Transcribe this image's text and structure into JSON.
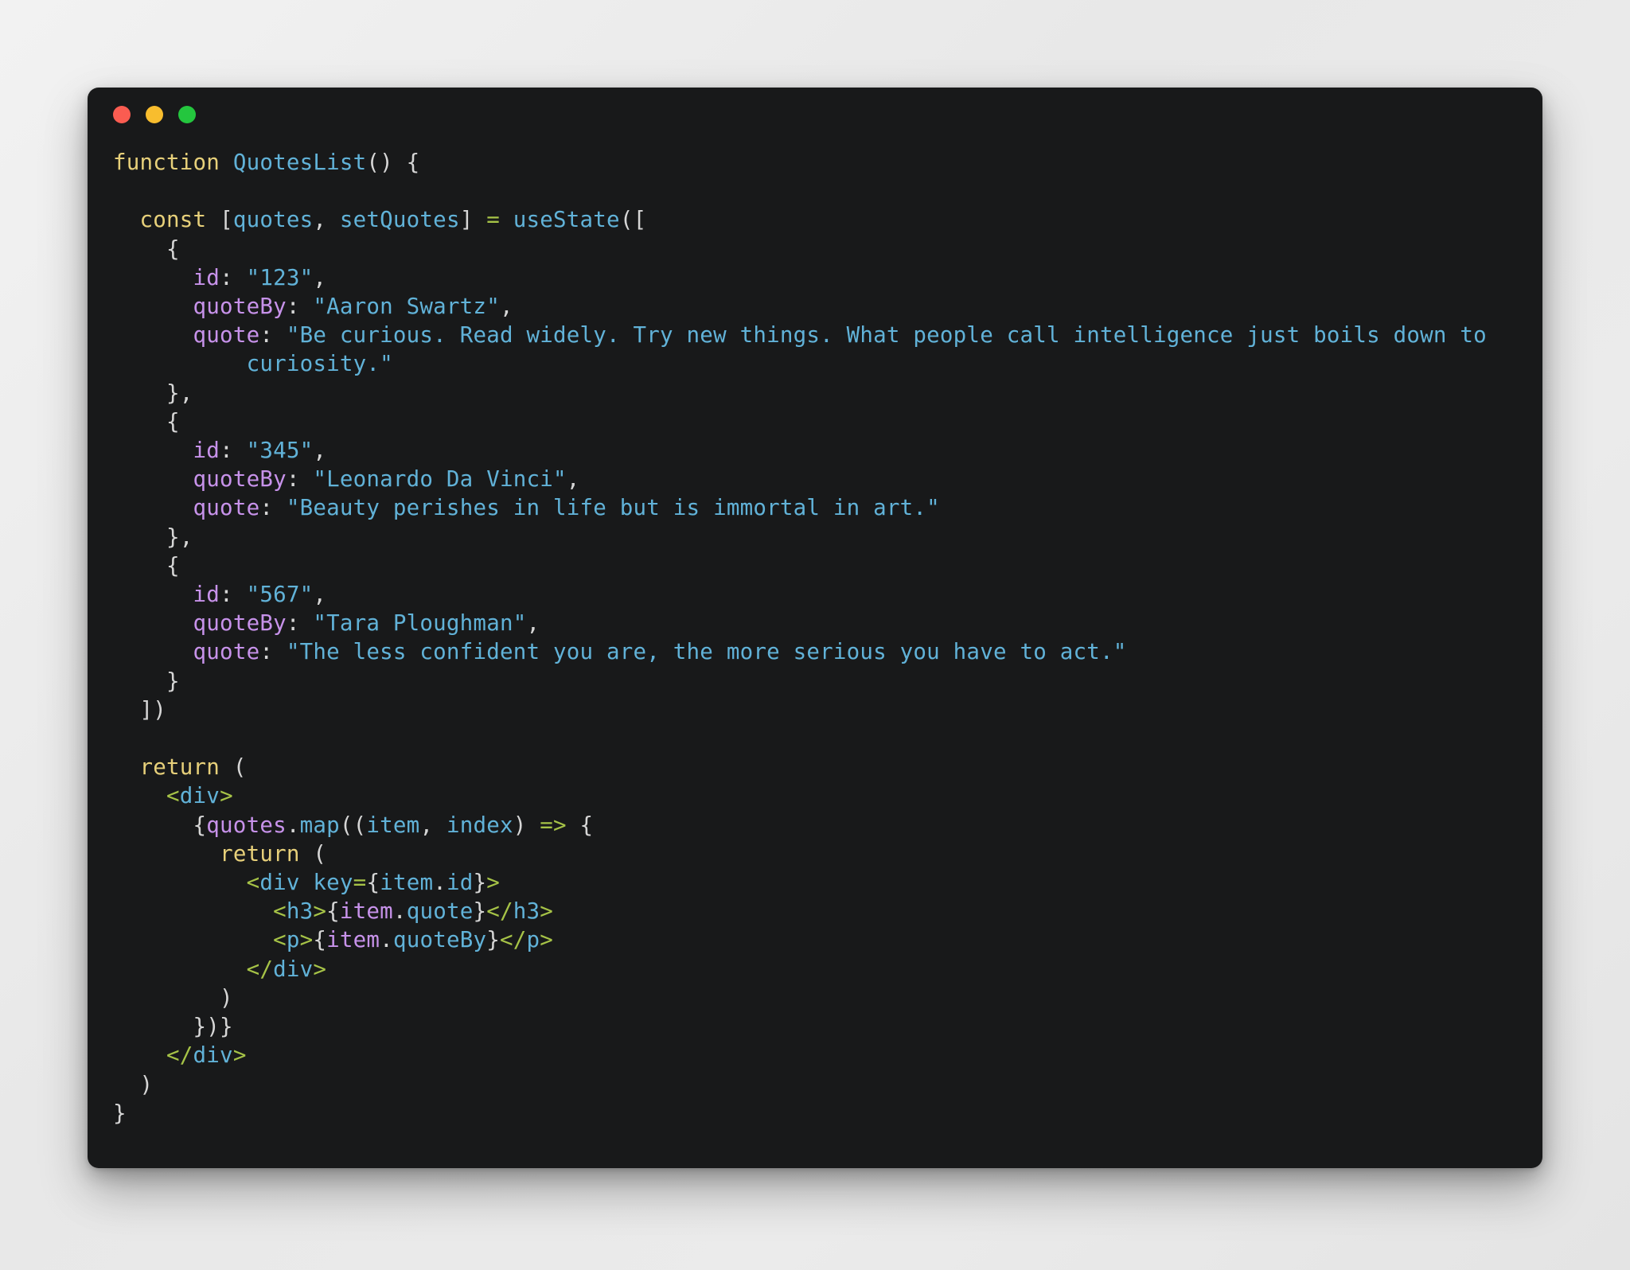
{
  "window": {
    "traffic_lights": [
      {
        "name": "close-button",
        "color": "#fa5c51"
      },
      {
        "name": "minimize-button",
        "color": "#f8bd2e"
      },
      {
        "name": "maximize-button",
        "color": "#24c63e"
      }
    ]
  },
  "theme": {
    "page_background": "#ebebeb",
    "window_background": "#18191a",
    "keyword": "#e7d07a",
    "identifier": "#61b2d8",
    "string": "#61b2d8",
    "operator": "#a6c347",
    "variable": "#c792ea",
    "punctuation": "#d6d6d6"
  },
  "code": {
    "language": "jsx",
    "component_name": "QuotesList",
    "state_hook": "useState",
    "state_variable": "quotes",
    "state_setter": "setQuotes",
    "quotes": [
      {
        "id": "123",
        "quoteBy": "Aaron Swartz",
        "quote": "Be curious. Read widely. Try new things. What people call intelligence just boils down to curiosity."
      },
      {
        "id": "345",
        "quoteBy": "Leonardo Da Vinci",
        "quote": "Beauty perishes in life but is immortal in art."
      },
      {
        "id": "567",
        "quoteBy": "Tara Ploughman",
        "quote": "The less confident you are, the more serious you have to act."
      }
    ],
    "lines": [
      [
        {
          "t": "function ",
          "c": "kw"
        },
        {
          "t": "QuotesList",
          "c": "fn"
        },
        {
          "t": "() {",
          "c": "pun"
        }
      ],
      [
        {
          "t": "",
          "c": "pun"
        }
      ],
      [
        {
          "t": "  ",
          "c": "pun"
        },
        {
          "t": "const",
          "c": "kw"
        },
        {
          "t": " [",
          "c": "pun"
        },
        {
          "t": "quotes",
          "c": "fn"
        },
        {
          "t": ", ",
          "c": "pun"
        },
        {
          "t": "setQuotes",
          "c": "fn"
        },
        {
          "t": "] ",
          "c": "pun"
        },
        {
          "t": "=",
          "c": "op"
        },
        {
          "t": " ",
          "c": "pun"
        },
        {
          "t": "useState",
          "c": "fn"
        },
        {
          "t": "([",
          "c": "pun"
        }
      ],
      [
        {
          "t": "    {",
          "c": "pun"
        }
      ],
      [
        {
          "t": "      ",
          "c": "pun"
        },
        {
          "t": "id",
          "c": "var"
        },
        {
          "t": ": ",
          "c": "pun"
        },
        {
          "t": "\"123\"",
          "c": "str"
        },
        {
          "t": ",",
          "c": "pun"
        }
      ],
      [
        {
          "t": "      ",
          "c": "pun"
        },
        {
          "t": "quoteBy",
          "c": "var"
        },
        {
          "t": ": ",
          "c": "pun"
        },
        {
          "t": "\"Aaron Swartz\"",
          "c": "str"
        },
        {
          "t": ",",
          "c": "pun"
        }
      ],
      [
        {
          "t": "      ",
          "c": "pun"
        },
        {
          "t": "quote",
          "c": "var"
        },
        {
          "t": ": ",
          "c": "pun"
        },
        {
          "t": "\"Be curious. Read widely. Try new things. What people call intelligence just boils down to",
          "c": "str"
        }
      ],
      [
        {
          "t": "          ",
          "c": "pun"
        },
        {
          "t": "curiosity.\"",
          "c": "str"
        }
      ],
      [
        {
          "t": "    },",
          "c": "pun"
        }
      ],
      [
        {
          "t": "    {",
          "c": "pun"
        }
      ],
      [
        {
          "t": "      ",
          "c": "pun"
        },
        {
          "t": "id",
          "c": "var"
        },
        {
          "t": ": ",
          "c": "pun"
        },
        {
          "t": "\"345\"",
          "c": "str"
        },
        {
          "t": ",",
          "c": "pun"
        }
      ],
      [
        {
          "t": "      ",
          "c": "pun"
        },
        {
          "t": "quoteBy",
          "c": "var"
        },
        {
          "t": ": ",
          "c": "pun"
        },
        {
          "t": "\"Leonardo Da Vinci\"",
          "c": "str"
        },
        {
          "t": ",",
          "c": "pun"
        }
      ],
      [
        {
          "t": "      ",
          "c": "pun"
        },
        {
          "t": "quote",
          "c": "var"
        },
        {
          "t": ": ",
          "c": "pun"
        },
        {
          "t": "\"Beauty perishes in life but is immortal in art.\"",
          "c": "str"
        }
      ],
      [
        {
          "t": "    },",
          "c": "pun"
        }
      ],
      [
        {
          "t": "    {",
          "c": "pun"
        }
      ],
      [
        {
          "t": "      ",
          "c": "pun"
        },
        {
          "t": "id",
          "c": "var"
        },
        {
          "t": ": ",
          "c": "pun"
        },
        {
          "t": "\"567\"",
          "c": "str"
        },
        {
          "t": ",",
          "c": "pun"
        }
      ],
      [
        {
          "t": "      ",
          "c": "pun"
        },
        {
          "t": "quoteBy",
          "c": "var"
        },
        {
          "t": ": ",
          "c": "pun"
        },
        {
          "t": "\"Tara Ploughman\"",
          "c": "str"
        },
        {
          "t": ",",
          "c": "pun"
        }
      ],
      [
        {
          "t": "      ",
          "c": "pun"
        },
        {
          "t": "quote",
          "c": "var"
        },
        {
          "t": ": ",
          "c": "pun"
        },
        {
          "t": "\"The less confident you are, the more serious you have to act.\"",
          "c": "str"
        }
      ],
      [
        {
          "t": "    }",
          "c": "pun"
        }
      ],
      [
        {
          "t": "  ])",
          "c": "pun"
        }
      ],
      [
        {
          "t": "",
          "c": "pun"
        }
      ],
      [
        {
          "t": "  ",
          "c": "pun"
        },
        {
          "t": "return",
          "c": "kw"
        },
        {
          "t": " (",
          "c": "pun"
        }
      ],
      [
        {
          "t": "    ",
          "c": "pun"
        },
        {
          "t": "<",
          "c": "op"
        },
        {
          "t": "div",
          "c": "fn"
        },
        {
          "t": ">",
          "c": "op"
        }
      ],
      [
        {
          "t": "      {",
          "c": "pun"
        },
        {
          "t": "quotes",
          "c": "var"
        },
        {
          "t": ".",
          "c": "pun"
        },
        {
          "t": "map",
          "c": "fn"
        },
        {
          "t": "((",
          "c": "pun"
        },
        {
          "t": "item",
          "c": "fn"
        },
        {
          "t": ", ",
          "c": "pun"
        },
        {
          "t": "index",
          "c": "fn"
        },
        {
          "t": ") ",
          "c": "pun"
        },
        {
          "t": "=>",
          "c": "op"
        },
        {
          "t": " {",
          "c": "pun"
        }
      ],
      [
        {
          "t": "        ",
          "c": "pun"
        },
        {
          "t": "return",
          "c": "kw"
        },
        {
          "t": " (",
          "c": "pun"
        }
      ],
      [
        {
          "t": "          ",
          "c": "pun"
        },
        {
          "t": "<",
          "c": "op"
        },
        {
          "t": "div",
          "c": "fn"
        },
        {
          "t": " ",
          "c": "pun"
        },
        {
          "t": "key",
          "c": "fn"
        },
        {
          "t": "=",
          "c": "op"
        },
        {
          "t": "{",
          "c": "pun"
        },
        {
          "t": "item",
          "c": "fn"
        },
        {
          "t": ".",
          "c": "pun"
        },
        {
          "t": "id",
          "c": "fn"
        },
        {
          "t": "}",
          "c": "pun"
        },
        {
          "t": ">",
          "c": "op"
        }
      ],
      [
        {
          "t": "            ",
          "c": "pun"
        },
        {
          "t": "<",
          "c": "op"
        },
        {
          "t": "h3",
          "c": "fn"
        },
        {
          "t": ">",
          "c": "op"
        },
        {
          "t": "{",
          "c": "pun"
        },
        {
          "t": "item",
          "c": "var"
        },
        {
          "t": ".",
          "c": "pun"
        },
        {
          "t": "quote",
          "c": "fn"
        },
        {
          "t": "}",
          "c": "pun"
        },
        {
          "t": "</",
          "c": "op"
        },
        {
          "t": "h3",
          "c": "fn"
        },
        {
          "t": ">",
          "c": "op"
        }
      ],
      [
        {
          "t": "            ",
          "c": "pun"
        },
        {
          "t": "<",
          "c": "op"
        },
        {
          "t": "p",
          "c": "fn"
        },
        {
          "t": ">",
          "c": "op"
        },
        {
          "t": "{",
          "c": "pun"
        },
        {
          "t": "item",
          "c": "var"
        },
        {
          "t": ".",
          "c": "pun"
        },
        {
          "t": "quoteBy",
          "c": "fn"
        },
        {
          "t": "}",
          "c": "pun"
        },
        {
          "t": "</",
          "c": "op"
        },
        {
          "t": "p",
          "c": "fn"
        },
        {
          "t": ">",
          "c": "op"
        }
      ],
      [
        {
          "t": "          ",
          "c": "pun"
        },
        {
          "t": "</",
          "c": "op"
        },
        {
          "t": "div",
          "c": "fn"
        },
        {
          "t": ">",
          "c": "op"
        }
      ],
      [
        {
          "t": "        )",
          "c": "pun"
        }
      ],
      [
        {
          "t": "      })}",
          "c": "pun"
        }
      ],
      [
        {
          "t": "    ",
          "c": "pun"
        },
        {
          "t": "</",
          "c": "op"
        },
        {
          "t": "div",
          "c": "fn"
        },
        {
          "t": ">",
          "c": "op"
        }
      ],
      [
        {
          "t": "  )",
          "c": "pun"
        }
      ],
      [
        {
          "t": "}",
          "c": "pun"
        }
      ]
    ]
  }
}
